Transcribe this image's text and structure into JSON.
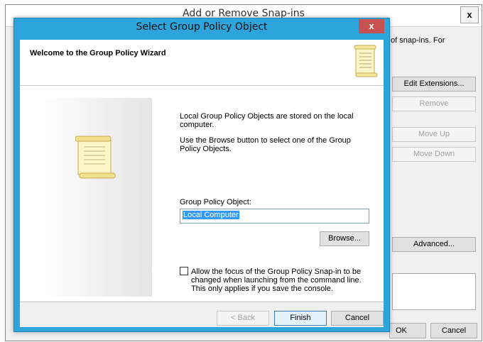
{
  "background_dialog": {
    "title": "Add or Remove Snap-ins",
    "close_glyph": "x",
    "description_fragment": "of snap-ins. For",
    "buttons": {
      "edit_extensions": "Edit Extensions...",
      "remove": "Remove",
      "move_up": "Move Up",
      "move_down": "Move Down",
      "advanced": "Advanced...",
      "ok": "OK",
      "cancel": "Cancel"
    }
  },
  "wizard": {
    "title": "Select Group Policy Object",
    "close_glyph": "x",
    "heading": "Welcome to the Group Policy Wizard",
    "info_line": "Local Group Policy Objects are stored on the local computer.",
    "browse_hint": "Use the Browse button to select one of the Group Policy Objects.",
    "gpo_label": "Group Policy Object:",
    "gpo_value": "Local Computer",
    "browse_label": "Browse...",
    "checkbox_label": "Allow the focus of the Group Policy Snap-in to be changed when launching from the command line.  This only applies if you save the console.",
    "checkbox_checked": false,
    "buttons": {
      "back": "< Back",
      "finish": "Finish",
      "cancel": "Cancel"
    },
    "icons": [
      "scroll-icon",
      "scroll-icon"
    ]
  },
  "colors": {
    "title_bar": "#2ea4dc",
    "close_button": "#c75050",
    "selection": "#3399ff"
  }
}
